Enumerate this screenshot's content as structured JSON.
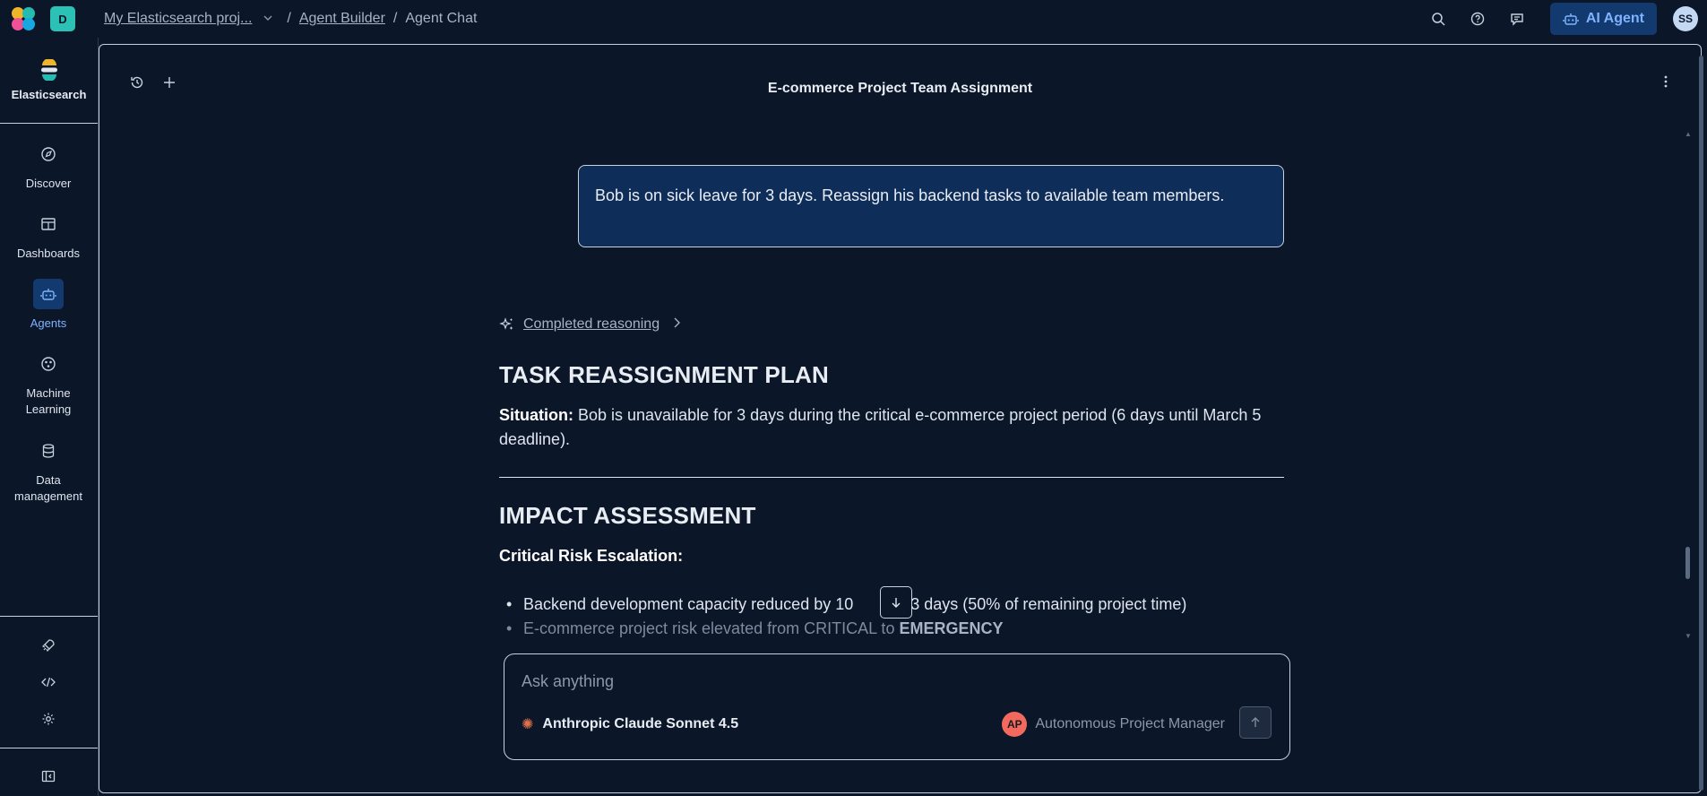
{
  "topbar": {
    "space_initial": "D",
    "breadcrumbs": [
      "My Elasticsearch proj...",
      "Agent Builder",
      "Agent Chat"
    ],
    "ai_agent_label": "AI Agent",
    "user_initials": "SS",
    "icons": [
      "search-icon",
      "help-icon",
      "feedback-icon",
      "robot-icon"
    ]
  },
  "sidenav": {
    "brand": "Elasticsearch",
    "items": [
      {
        "label": "Discover",
        "icon": "compass-icon"
      },
      {
        "label": "Dashboards",
        "icon": "dashboard-icon"
      },
      {
        "label": "Agents",
        "icon": "robot-icon",
        "active": true
      },
      {
        "label": "Machine\nLearning",
        "icon": "ml-icon"
      },
      {
        "label": "Data\nmanagement",
        "icon": "database-icon"
      }
    ],
    "tools": [
      "rocket-icon",
      "code-icon",
      "gear-icon",
      "collapse-icon"
    ]
  },
  "chat": {
    "title": "E-commerce Project Team Assignment",
    "user_message": "Bob is on sick leave for 3 days. Reassign his backend tasks to available team members.",
    "reasoning_label": "Completed reasoning",
    "heading_1": "TASK REASSIGNMENT PLAN",
    "situation_label": "Situation:",
    "situation_text": " Bob is unavailable for 3 days during the critical e-commerce project period (6 days until March 5 deadline).",
    "heading_2": "IMPACT ASSESSMENT",
    "risk_label": "Critical Risk Escalation:",
    "bullet_1a": "Backend development capacity reduced by 10",
    "bullet_1b": "for 3 days (50% of remaining project time)",
    "bullet_2a": "E-commerce project risk elevated from CRITICAL to ",
    "bullet_2b": "EMERGENCY"
  },
  "composer": {
    "placeholder": "Ask anything",
    "model": "Anthropic Claude Sonnet 4.5",
    "agent_initials": "AP",
    "agent_name": "Autonomous Project Manager"
  },
  "colors": {
    "background": "#0b1628",
    "accent": "#7fb3ff",
    "user_bubble": "#0f2d59",
    "agent_avatar": "#f26a5e",
    "space_badge": "#2bc1b5"
  }
}
